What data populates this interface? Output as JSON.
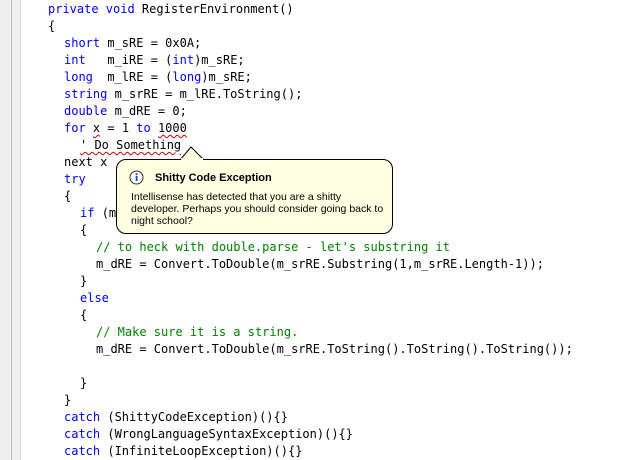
{
  "editor": {
    "lines": [
      {
        "segs": [
          {
            "t": "private void ",
            "k": "kw"
          },
          {
            "t": "RegisterEnvironment()",
            "k": ""
          }
        ]
      },
      {
        "segs": [
          {
            "t": "{",
            "k": ""
          }
        ]
      },
      {
        "segs": [
          {
            "t": "short ",
            "k": "kw"
          },
          {
            "t": "m_sRE = 0x0A;",
            "k": ""
          }
        ]
      },
      {
        "segs": [
          {
            "t": "int",
            "k": "kw"
          },
          {
            "t": "   m_iRE = (",
            "k": ""
          },
          {
            "t": "int",
            "k": "kw"
          },
          {
            "t": ")m_sRE;",
            "k": ""
          }
        ]
      },
      {
        "segs": [
          {
            "t": "long",
            "k": "kw"
          },
          {
            "t": "  m_lRE = (",
            "k": ""
          },
          {
            "t": "long",
            "k": "kw"
          },
          {
            "t": ")m_sRE;",
            "k": ""
          }
        ]
      },
      {
        "segs": [
          {
            "t": "string ",
            "k": "kw"
          },
          {
            "t": "m_srRE = m_lRE.ToString();",
            "k": ""
          }
        ]
      },
      {
        "segs": [
          {
            "t": "double ",
            "k": "kw"
          },
          {
            "t": "m_dRE = 0;",
            "k": ""
          }
        ]
      },
      {
        "segs": [
          {
            "t": "for ",
            "k": "kw"
          },
          {
            "t": "x",
            "k": "sq"
          },
          {
            "t": " = 1 ",
            "k": ""
          },
          {
            "t": "to",
            "k": "kw"
          },
          {
            "t": " ",
            "k": ""
          },
          {
            "t": "1000",
            "k": "sq"
          }
        ]
      },
      {
        "segs": [
          {
            "t": "' Do Something",
            "k": "sq"
          }
        ]
      },
      {
        "segs": [
          {
            "t": "next x",
            "k": ""
          }
        ]
      },
      {
        "segs": [
          {
            "t": "try",
            "k": "kw"
          }
        ]
      },
      {
        "segs": [
          {
            "t": "{",
            "k": ""
          }
        ]
      },
      {
        "segs": [
          {
            "t": "if ",
            "k": "kw"
          },
          {
            "t": "(m",
            "k": ""
          }
        ]
      },
      {
        "segs": [
          {
            "t": "{",
            "k": ""
          }
        ]
      },
      {
        "segs": [
          {
            "t": "// to heck with double.parse - let's substring it",
            "k": "cm"
          }
        ]
      },
      {
        "segs": [
          {
            "t": "m_dRE = Convert.ToDouble(m_srRE.Substring(1,m_srRE.Length-1));",
            "k": ""
          }
        ]
      },
      {
        "segs": [
          {
            "t": "}",
            "k": ""
          }
        ]
      },
      {
        "segs": [
          {
            "t": "else",
            "k": "kw"
          }
        ]
      },
      {
        "segs": [
          {
            "t": "{",
            "k": ""
          }
        ]
      },
      {
        "segs": [
          {
            "t": "// Make sure it is a string.",
            "k": "cm"
          }
        ]
      },
      {
        "segs": [
          {
            "t": "m_dRE = Convert.ToDouble(m_srRE.ToString().ToString().ToString());",
            "k": ""
          }
        ]
      },
      {
        "segs": [
          {
            "t": "",
            "k": ""
          }
        ]
      },
      {
        "segs": [
          {
            "t": "}",
            "k": ""
          }
        ]
      },
      {
        "segs": [
          {
            "t": "}",
            "k": ""
          }
        ]
      },
      {
        "segs": [
          {
            "t": "catch ",
            "k": "kw"
          },
          {
            "t": "(ShittyCodeException)(){}",
            "k": ""
          }
        ]
      },
      {
        "segs": [
          {
            "t": "catch ",
            "k": "kw"
          },
          {
            "t": "(WrongLanguageSyntaxException)(){}",
            "k": ""
          }
        ]
      },
      {
        "segs": [
          {
            "t": "catch ",
            "k": "kw"
          },
          {
            "t": "(InfiniteLoopException)(){}",
            "k": ""
          }
        ]
      }
    ]
  },
  "tooltip": {
    "icon": "info-icon",
    "title": "Shitty Code Exception",
    "body": "Intellisense has detected that you are a shitty developer.  Perhaps you should consider going back to night school?"
  },
  "colors": {
    "keyword": "#0000ff",
    "comment": "#008000",
    "squiggle": "#d40000",
    "tooltip_bg": "#ffffe1"
  }
}
